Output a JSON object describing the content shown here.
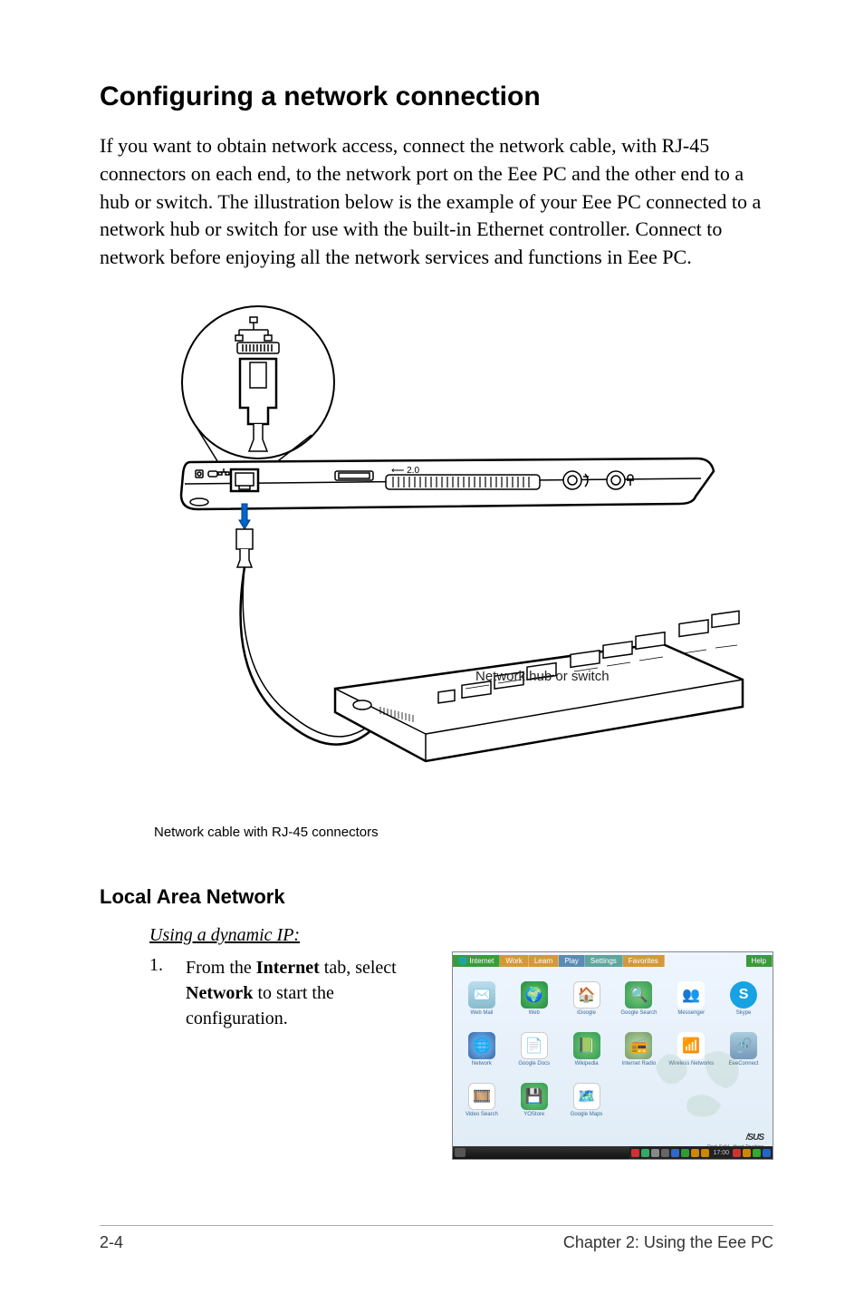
{
  "heading": "Configuring a network connection",
  "intro": "If you want to obtain network access, connect the network cable, with RJ-45 connectors on each end, to the network port on the Eee PC and the other end to a hub or switch. The illustration below is the example of your Eee PC connected to a network hub or switch for use with the built-in Ethernet controller. Connect to network before enjoying all the network services and functions in Eee PC.",
  "diagram": {
    "hub_label": "Network hub or switch",
    "cable_caption": "Network cable with RJ-45 connectors"
  },
  "lan_heading": "Local Area Network",
  "dynamic_ip_heading": "Using a dynamic IP:",
  "step1_num": "1.",
  "step1_text_pre": "From the ",
  "step1_text_bold1": "Internet",
  "step1_text_mid": " tab, select ",
  "step1_text_bold2": "Network",
  "step1_text_post": " to start the configuration.",
  "screenshot": {
    "tabs": {
      "internet": "Internet",
      "work": "Work",
      "learn": "Learn",
      "play": "Play",
      "settings": "Settings",
      "favorites": "Favorites",
      "help": "Help"
    },
    "icons": {
      "r1": [
        "Web Mail",
        "Web",
        "iGoogle",
        "Google Search",
        "Messenger",
        "Skype"
      ],
      "r2": [
        "Network",
        "Google Docs",
        "Wikipedia",
        "Internet Radio",
        "Wireless Networks",
        "EeeConnect"
      ],
      "r3": [
        "Video Search",
        "YOStore",
        "Google Maps"
      ]
    },
    "logo": "/SUS",
    "logo_sub": "Rock Solid · Heart Touching",
    "time": "17:00"
  },
  "footer": {
    "page": "2-4",
    "chapter": "Chapter 2: Using the Eee PC"
  }
}
